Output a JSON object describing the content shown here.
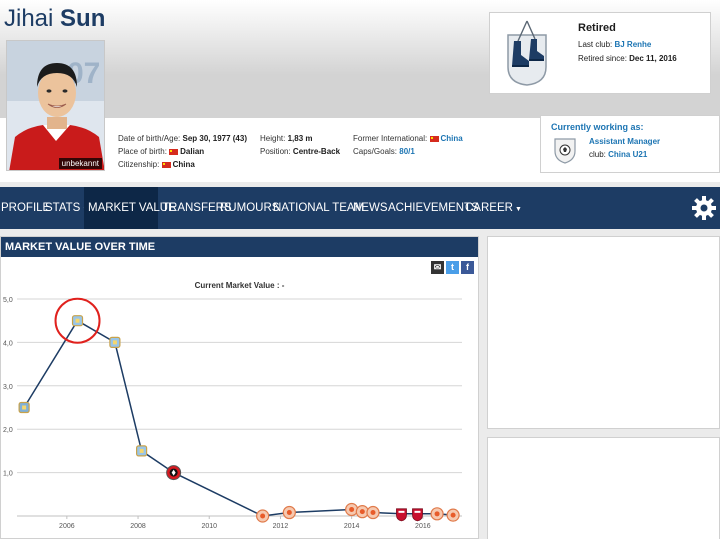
{
  "player": {
    "first_name": "Jihai",
    "last_name": "Sun",
    "photo_caption": "unbekannt"
  },
  "facts": {
    "dob_label": "Date of birth/Age:",
    "dob_value": "Sep 30, 1977 (43)",
    "pob_label": "Place of birth:",
    "pob_value": "Dalian",
    "citizenship_label": "Citizenship:",
    "citizenship_value": "China",
    "height_label": "Height:",
    "height_value": "1,83 m",
    "position_label": "Position:",
    "position_value": "Centre-Back",
    "former_int_label": "Former International:",
    "former_int_value": "China",
    "caps_label": "Caps/Goals:",
    "caps_value": "80/1"
  },
  "status": {
    "title": "Retired",
    "last_club_label": "Last club:",
    "last_club_value": "BJ Renhe",
    "retired_since_label": "Retired since:",
    "retired_since_value": "Dec 11, 2016",
    "icon": "hanging-boots-icon"
  },
  "working": {
    "title": "Currently working as:",
    "role": "Assistant Manager",
    "club_label": "club:",
    "club_value": "China U21",
    "icon": "club-crest-icon"
  },
  "nav": {
    "items": [
      {
        "label": "PROFILE"
      },
      {
        "label": "STATS"
      },
      {
        "label": "MARKET VALUE"
      },
      {
        "label": "TRANSFERS"
      },
      {
        "label": "RUMOURS"
      },
      {
        "label": "NATIONAL TEAM"
      },
      {
        "label": "NEWS"
      },
      {
        "label": "ACHIEVEMENTS"
      },
      {
        "label": "CAREER"
      }
    ],
    "active": "MARKET VALUE",
    "settings_icon": "gear-icon"
  },
  "market_value": {
    "header": "MARKET VALUE OVER TIME",
    "current_label": "Current Market Value : -",
    "share_icons": [
      "email-icon",
      "twitter-icon",
      "facebook-icon"
    ]
  },
  "colors": {
    "brand": "#1d3c64",
    "link": "#1d75b3",
    "highlight_circle": "#e0211d"
  },
  "chart_data": {
    "type": "line",
    "title": "Current Market Value : -",
    "xlabel": "",
    "ylabel": "",
    "x_ticks": [
      "2006",
      "2008",
      "2010",
      "2012",
      "2014",
      "2016"
    ],
    "y_ticks": [
      "1,0",
      "2,0",
      "3,0",
      "4,0",
      "5,0"
    ],
    "ylim": [
      0,
      5
    ],
    "xlim": [
      2004.6,
      2017.1
    ],
    "grid": true,
    "series": [
      {
        "color": "#1d3c64",
        "points": [
          {
            "x": 2004.8,
            "y": 2.5,
            "club": "dalian"
          },
          {
            "x": 2006.3,
            "y": 4.5,
            "club": "mancity"
          },
          {
            "x": 2007.35,
            "y": 4.0,
            "club": "mancity"
          },
          {
            "x": 2008.1,
            "y": 1.5,
            "club": "mancity"
          },
          {
            "x": 2009.0,
            "y": 1.0,
            "club": "sheffield"
          },
          {
            "x": 2011.5,
            "y": 0.0,
            "club": "cn-orange"
          },
          {
            "x": 2012.25,
            "y": 0.08,
            "club": "cn-orange"
          },
          {
            "x": 2014.0,
            "y": 0.15,
            "club": "cn-orange"
          },
          {
            "x": 2014.3,
            "y": 0.1,
            "club": "cn-orange"
          },
          {
            "x": 2014.6,
            "y": 0.08,
            "club": "cn-orange"
          },
          {
            "x": 2015.4,
            "y": 0.05,
            "club": "cn-red"
          },
          {
            "x": 2015.85,
            "y": 0.05,
            "club": "cn-red"
          },
          {
            "x": 2016.4,
            "y": 0.05,
            "club": "cn-orange"
          },
          {
            "x": 2016.85,
            "y": 0.02,
            "club": "cn-orange"
          }
        ]
      }
    ],
    "highlight": {
      "x": 2006.3,
      "y": 4.5
    }
  }
}
